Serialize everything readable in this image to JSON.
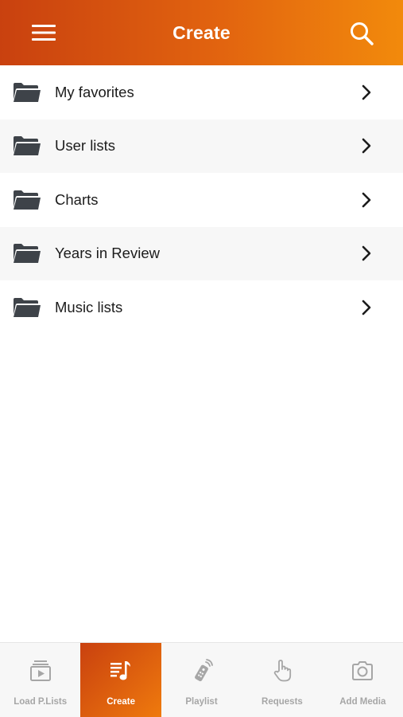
{
  "header": {
    "title": "Create",
    "menu_icon": "hamburger-menu-icon",
    "search_icon": "search-icon"
  },
  "list": {
    "items": [
      {
        "label": "My favorites",
        "icon": "folder-icon"
      },
      {
        "label": "User lists",
        "icon": "folder-icon"
      },
      {
        "label": "Charts",
        "icon": "folder-icon"
      },
      {
        "label": "Years in Review",
        "icon": "folder-icon"
      },
      {
        "label": "Music lists",
        "icon": "folder-icon"
      }
    ]
  },
  "tabbar": {
    "tabs": [
      {
        "label": "Load P.Lists",
        "icon": "load-playlists-icon",
        "active": false
      },
      {
        "label": "Create",
        "icon": "music-list-icon",
        "active": true
      },
      {
        "label": "Playlist",
        "icon": "remote-control-icon",
        "active": false
      },
      {
        "label": "Requests",
        "icon": "hand-pointer-icon",
        "active": false
      },
      {
        "label": "Add Media",
        "icon": "camera-icon",
        "active": false
      }
    ]
  },
  "colors": {
    "header_gradient_start": "#c9410f",
    "header_gradient_end": "#f28a0c",
    "icon_dark": "#3e4349",
    "tab_inactive": "#a6a6a6"
  }
}
